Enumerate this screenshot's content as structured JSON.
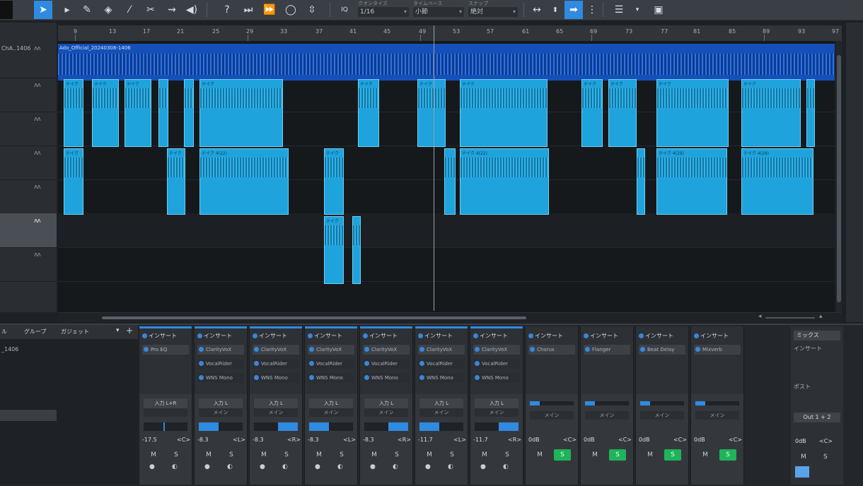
{
  "toolbar": {
    "tools": [
      "pointer",
      "range",
      "pencil",
      "eraser",
      "paint",
      "split",
      "bend",
      "listen"
    ],
    "quantize_label": "IQ",
    "quantize": {
      "label": "クオンタイズ",
      "value": "1/16"
    },
    "timebase": {
      "label": "タイムベース",
      "value": "小節"
    },
    "snap": {
      "label": "スナップ",
      "value": "絶対"
    }
  },
  "ruler": {
    "bars": [
      "9",
      "13",
      "17",
      "21",
      "25",
      "29",
      "33",
      "37",
      "41",
      "45",
      "49",
      "53",
      "57",
      "61",
      "65",
      "69",
      "73",
      "77",
      "81",
      "85",
      "89",
      "93",
      "97"
    ]
  },
  "tracks": {
    "master_name": "ChA..1406",
    "master_clip": "Ado_Official_20240308-1406"
  },
  "clip_labels": {
    "take": "テイク",
    "take_22": "テイク 4(22)",
    "take_29": "テイク 4(29)"
  },
  "mixer": {
    "header_tab1": "ル",
    "header_tab2": "グループ",
    "header_tab3": "ガジェット",
    "list_item": "_1406",
    "insert_label": "インサート",
    "channels": [
      {
        "plugins": [
          "Pro EQ"
        ],
        "io": "入力 L+R",
        "sub": "",
        "vol": "-17.5",
        "pan": "<C>",
        "solo": false
      },
      {
        "plugins": [
          "ClarityVoX",
          "VocalRider",
          "WNS Mono"
        ],
        "io": "入力 L",
        "sub": "メイン",
        "vol": "-8.3",
        "pan": "<L>",
        "solo": false
      },
      {
        "plugins": [
          "ClarityVoX",
          "VocalRider",
          "WNS Mono"
        ],
        "io": "入力 L",
        "sub": "メイン",
        "vol": "-8.3",
        "pan": "<R>",
        "solo": false
      },
      {
        "plugins": [
          "ClarityVoX",
          "VocalRider",
          "WNS Mono"
        ],
        "io": "入力 L",
        "sub": "メイン",
        "vol": "-8.3",
        "pan": "<L>",
        "solo": false
      },
      {
        "plugins": [
          "ClarityVoX",
          "VocalRider",
          "WNS Mono"
        ],
        "io": "入力 L",
        "sub": "メイン",
        "vol": "-8.3",
        "pan": "<R>",
        "solo": false
      },
      {
        "plugins": [
          "ClarityVoX",
          "VocalRider",
          "WNS Mono"
        ],
        "io": "入力 L",
        "sub": "メイン",
        "vol": "-11.7",
        "pan": "<L>",
        "solo": false
      },
      {
        "plugins": [
          "ClarityVoX",
          "VocalRider",
          "WNS Mono"
        ],
        "io": "入力 L",
        "sub": "メイン",
        "vol": "-11.7",
        "pan": "<R>",
        "solo": false
      }
    ],
    "fx_channels": [
      {
        "plugin": "Chorus",
        "vol": "0dB",
        "pan": "<C>",
        "solo": true
      },
      {
        "plugin": "Flanger",
        "vol": "0dB",
        "pan": "<C>",
        "solo": true
      },
      {
        "plugin": "Beat Delay",
        "vol": "0dB",
        "pan": "<C>",
        "solo": true
      },
      {
        "plugin": "Mixverb",
        "vol": "0dB",
        "pan": "<C>",
        "solo": true
      }
    ],
    "main": {
      "title": "ミックス",
      "insert": "インサート",
      "post": "ポスト",
      "out": "Out 1 + 2",
      "vol": "0dB",
      "pan": "<C>"
    },
    "sub_fx": "メイン",
    "mute": "M",
    "solo": "S"
  }
}
